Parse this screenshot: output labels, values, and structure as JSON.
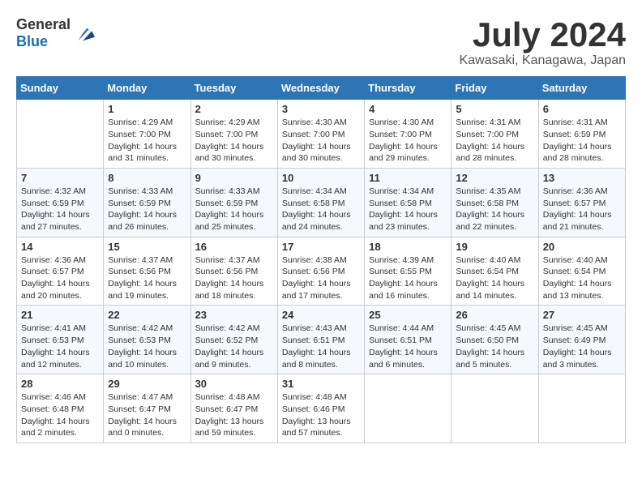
{
  "header": {
    "logo_general": "General",
    "logo_blue": "Blue",
    "month_year": "July 2024",
    "location": "Kawasaki, Kanagawa, Japan"
  },
  "calendar": {
    "days_of_week": [
      "Sunday",
      "Monday",
      "Tuesday",
      "Wednesday",
      "Thursday",
      "Friday",
      "Saturday"
    ],
    "weeks": [
      [
        {
          "day": "",
          "sunrise": "",
          "sunset": "",
          "daylight": ""
        },
        {
          "day": "1",
          "sunrise": "Sunrise: 4:29 AM",
          "sunset": "Sunset: 7:00 PM",
          "daylight": "Daylight: 14 hours and 31 minutes."
        },
        {
          "day": "2",
          "sunrise": "Sunrise: 4:29 AM",
          "sunset": "Sunset: 7:00 PM",
          "daylight": "Daylight: 14 hours and 30 minutes."
        },
        {
          "day": "3",
          "sunrise": "Sunrise: 4:30 AM",
          "sunset": "Sunset: 7:00 PM",
          "daylight": "Daylight: 14 hours and 30 minutes."
        },
        {
          "day": "4",
          "sunrise": "Sunrise: 4:30 AM",
          "sunset": "Sunset: 7:00 PM",
          "daylight": "Daylight: 14 hours and 29 minutes."
        },
        {
          "day": "5",
          "sunrise": "Sunrise: 4:31 AM",
          "sunset": "Sunset: 7:00 PM",
          "daylight": "Daylight: 14 hours and 28 minutes."
        },
        {
          "day": "6",
          "sunrise": "Sunrise: 4:31 AM",
          "sunset": "Sunset: 6:59 PM",
          "daylight": "Daylight: 14 hours and 28 minutes."
        }
      ],
      [
        {
          "day": "7",
          "sunrise": "Sunrise: 4:32 AM",
          "sunset": "Sunset: 6:59 PM",
          "daylight": "Daylight: 14 hours and 27 minutes."
        },
        {
          "day": "8",
          "sunrise": "Sunrise: 4:33 AM",
          "sunset": "Sunset: 6:59 PM",
          "daylight": "Daylight: 14 hours and 26 minutes."
        },
        {
          "day": "9",
          "sunrise": "Sunrise: 4:33 AM",
          "sunset": "Sunset: 6:59 PM",
          "daylight": "Daylight: 14 hours and 25 minutes."
        },
        {
          "day": "10",
          "sunrise": "Sunrise: 4:34 AM",
          "sunset": "Sunset: 6:58 PM",
          "daylight": "Daylight: 14 hours and 24 minutes."
        },
        {
          "day": "11",
          "sunrise": "Sunrise: 4:34 AM",
          "sunset": "Sunset: 6:58 PM",
          "daylight": "Daylight: 14 hours and 23 minutes."
        },
        {
          "day": "12",
          "sunrise": "Sunrise: 4:35 AM",
          "sunset": "Sunset: 6:58 PM",
          "daylight": "Daylight: 14 hours and 22 minutes."
        },
        {
          "day": "13",
          "sunrise": "Sunrise: 4:36 AM",
          "sunset": "Sunset: 6:57 PM",
          "daylight": "Daylight: 14 hours and 21 minutes."
        }
      ],
      [
        {
          "day": "14",
          "sunrise": "Sunrise: 4:36 AM",
          "sunset": "Sunset: 6:57 PM",
          "daylight": "Daylight: 14 hours and 20 minutes."
        },
        {
          "day": "15",
          "sunrise": "Sunrise: 4:37 AM",
          "sunset": "Sunset: 6:56 PM",
          "daylight": "Daylight: 14 hours and 19 minutes."
        },
        {
          "day": "16",
          "sunrise": "Sunrise: 4:37 AM",
          "sunset": "Sunset: 6:56 PM",
          "daylight": "Daylight: 14 hours and 18 minutes."
        },
        {
          "day": "17",
          "sunrise": "Sunrise: 4:38 AM",
          "sunset": "Sunset: 6:56 PM",
          "daylight": "Daylight: 14 hours and 17 minutes."
        },
        {
          "day": "18",
          "sunrise": "Sunrise: 4:39 AM",
          "sunset": "Sunset: 6:55 PM",
          "daylight": "Daylight: 14 hours and 16 minutes."
        },
        {
          "day": "19",
          "sunrise": "Sunrise: 4:40 AM",
          "sunset": "Sunset: 6:54 PM",
          "daylight": "Daylight: 14 hours and 14 minutes."
        },
        {
          "day": "20",
          "sunrise": "Sunrise: 4:40 AM",
          "sunset": "Sunset: 6:54 PM",
          "daylight": "Daylight: 14 hours and 13 minutes."
        }
      ],
      [
        {
          "day": "21",
          "sunrise": "Sunrise: 4:41 AM",
          "sunset": "Sunset: 6:53 PM",
          "daylight": "Daylight: 14 hours and 12 minutes."
        },
        {
          "day": "22",
          "sunrise": "Sunrise: 4:42 AM",
          "sunset": "Sunset: 6:53 PM",
          "daylight": "Daylight: 14 hours and 10 minutes."
        },
        {
          "day": "23",
          "sunrise": "Sunrise: 4:42 AM",
          "sunset": "Sunset: 6:52 PM",
          "daylight": "Daylight: 14 hours and 9 minutes."
        },
        {
          "day": "24",
          "sunrise": "Sunrise: 4:43 AM",
          "sunset": "Sunset: 6:51 PM",
          "daylight": "Daylight: 14 hours and 8 minutes."
        },
        {
          "day": "25",
          "sunrise": "Sunrise: 4:44 AM",
          "sunset": "Sunset: 6:51 PM",
          "daylight": "Daylight: 14 hours and 6 minutes."
        },
        {
          "day": "26",
          "sunrise": "Sunrise: 4:45 AM",
          "sunset": "Sunset: 6:50 PM",
          "daylight": "Daylight: 14 hours and 5 minutes."
        },
        {
          "day": "27",
          "sunrise": "Sunrise: 4:45 AM",
          "sunset": "Sunset: 6:49 PM",
          "daylight": "Daylight: 14 hours and 3 minutes."
        }
      ],
      [
        {
          "day": "28",
          "sunrise": "Sunrise: 4:46 AM",
          "sunset": "Sunset: 6:48 PM",
          "daylight": "Daylight: 14 hours and 2 minutes."
        },
        {
          "day": "29",
          "sunrise": "Sunrise: 4:47 AM",
          "sunset": "Sunset: 6:47 PM",
          "daylight": "Daylight: 14 hours and 0 minutes."
        },
        {
          "day": "30",
          "sunrise": "Sunrise: 4:48 AM",
          "sunset": "Sunset: 6:47 PM",
          "daylight": "Daylight: 13 hours and 59 minutes."
        },
        {
          "day": "31",
          "sunrise": "Sunrise: 4:48 AM",
          "sunset": "Sunset: 6:46 PM",
          "daylight": "Daylight: 13 hours and 57 minutes."
        },
        {
          "day": "",
          "sunrise": "",
          "sunset": "",
          "daylight": ""
        },
        {
          "day": "",
          "sunrise": "",
          "sunset": "",
          "daylight": ""
        },
        {
          "day": "",
          "sunrise": "",
          "sunset": "",
          "daylight": ""
        }
      ]
    ]
  }
}
